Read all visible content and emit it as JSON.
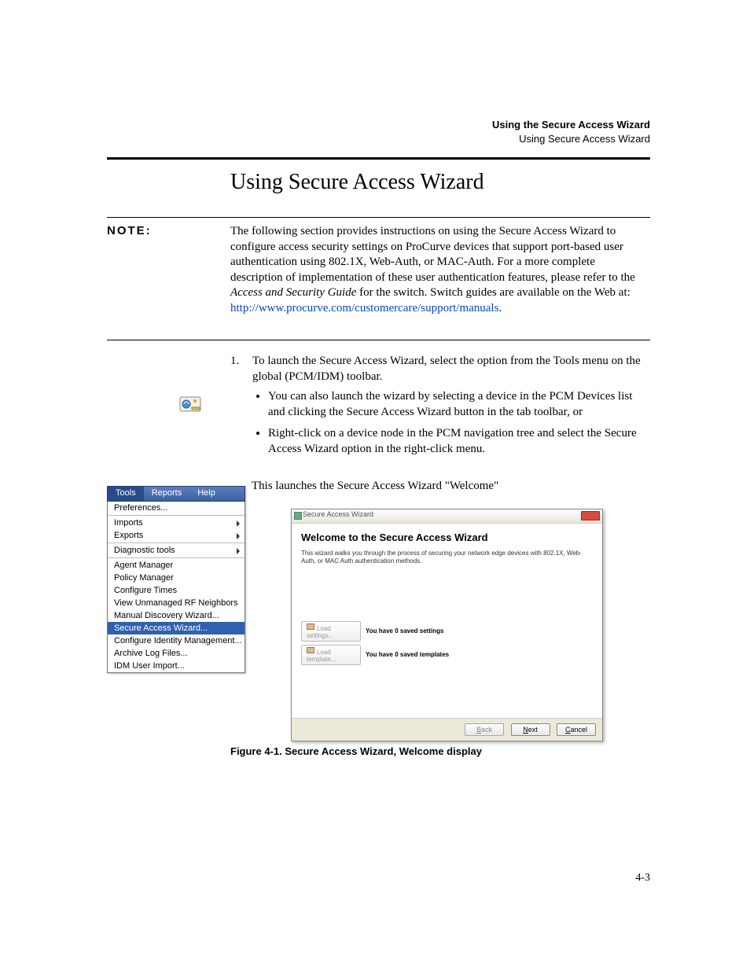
{
  "header": {
    "bold_line": "Using the Secure Access Wizard",
    "sub_line": "Using Secure Access Wizard"
  },
  "title": "Using Secure Access Wizard",
  "note": {
    "label": "NOTE:",
    "body_pre": "The following section provides instructions on using the Secure Access Wizard to configure access security settings on ProCurve devices that support port-based user authentication using 802.1X, Web-Auth, or MAC-Auth. For a more complete description of implementation of these user authentication features, please refer to the ",
    "body_em": "Access and Security Guide",
    "body_post": " for the switch. Switch guides are available on the Web at: ",
    "link_text": "http://www.procurve.com/customercare/support/manuals",
    "body_end": "."
  },
  "step": {
    "num": "1.",
    "text": "To launch the Secure Access Wizard, select the option from the Tools menu on the global (PCM/IDM) toolbar.",
    "bullets": [
      "You can also launch the wizard by selecting a device in the PCM Devices list and clicking the Secure Access Wizard button in the tab toolbar, or",
      "Right-click on a device node in the PCM navigation tree and select the Secure Access Wizard option in the right-click menu."
    ]
  },
  "launch_line": "This launches the Secure Access Wizard \"Welcome\"",
  "menu": {
    "bar": [
      "Tools",
      "Reports",
      "Help"
    ],
    "items": [
      {
        "label": "Preferences...",
        "arrow": false
      },
      {
        "sep": true
      },
      {
        "label": "Imports",
        "arrow": true
      },
      {
        "label": "Exports",
        "arrow": true
      },
      {
        "sep": true
      },
      {
        "label": "Diagnostic tools",
        "arrow": true
      },
      {
        "sep": true
      },
      {
        "label": "Agent Manager",
        "arrow": false
      },
      {
        "label": "Policy Manager",
        "arrow": false
      },
      {
        "label": "Configure Times",
        "arrow": false
      },
      {
        "label": "View Unmanaged RF Neighbors",
        "arrow": false
      },
      {
        "label": "Manual Discovery Wizard...",
        "arrow": false
      },
      {
        "label": "Secure Access Wizard...",
        "arrow": false,
        "selected": true
      },
      {
        "label": "Configure Identity Management...",
        "arrow": false
      },
      {
        "label": "Archive Log Files...",
        "arrow": false
      },
      {
        "label": "IDM User Import...",
        "arrow": false
      }
    ]
  },
  "wizard": {
    "title": "Secure Access Wizard",
    "heading": "Welcome to the Secure Access Wizard",
    "desc": "This wizard walks you through the process of securing your network edge devices with 802.1X, Web-Auth, or MAC Auth authentication methods.",
    "load_settings_btn": "Load settings...",
    "load_settings_msg": "You have 0 saved settings",
    "load_template_btn": "Load template...",
    "load_template_msg": "You have 0 saved templates",
    "back": "Back",
    "next": "Next",
    "cancel": "Cancel"
  },
  "figcap": "Figure 4-1. Secure Access Wizard, Welcome display",
  "pagenum": "4-3"
}
